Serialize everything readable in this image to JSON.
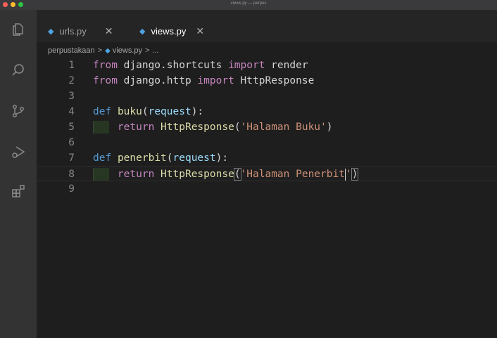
{
  "window": {
    "title": "views.py — perpus",
    "traffic_colors": [
      "#ff5f57",
      "#febc2e",
      "#28c840"
    ]
  },
  "activity_bar": {
    "icons": [
      "files-icon",
      "search-icon",
      "source-control-icon",
      "run-debug-icon",
      "extensions-icon"
    ]
  },
  "tabs": [
    {
      "label": "urls.py",
      "active": false,
      "close": "✕"
    },
    {
      "label": "views.py",
      "active": true,
      "close": "✕"
    }
  ],
  "breadcrumb": {
    "folder": "perpustakaan",
    "sep": ">",
    "file": "views.py",
    "tail": "..."
  },
  "code_lines": [
    {
      "n": "1",
      "tokens": [
        {
          "t": "from",
          "c": "kw"
        },
        {
          "t": " django.shortcuts ",
          "c": ""
        },
        {
          "t": "import",
          "c": "kw"
        },
        {
          "t": " render",
          "c": ""
        }
      ]
    },
    {
      "n": "2",
      "tokens": [
        {
          "t": "from",
          "c": "kw"
        },
        {
          "t": " django.http ",
          "c": ""
        },
        {
          "t": "import",
          "c": "kw"
        },
        {
          "t": " HttpResponse",
          "c": ""
        }
      ]
    },
    {
      "n": "3",
      "tokens": []
    },
    {
      "n": "4",
      "tokens": [
        {
          "t": "def",
          "c": "def"
        },
        {
          "t": " ",
          "c": ""
        },
        {
          "t": "buku",
          "c": "fn"
        },
        {
          "t": "(",
          "c": ""
        },
        {
          "t": "request",
          "c": "param"
        },
        {
          "t": "):",
          "c": ""
        }
      ]
    },
    {
      "n": "5",
      "indent": true,
      "tokens": [
        {
          "t": "    ",
          "c": ""
        },
        {
          "t": "return",
          "c": "kw"
        },
        {
          "t": " ",
          "c": ""
        },
        {
          "t": "HttpResponse",
          "c": "fn"
        },
        {
          "t": "(",
          "c": ""
        },
        {
          "t": "'Halaman Buku'",
          "c": "str"
        },
        {
          "t": ")",
          "c": ""
        }
      ]
    },
    {
      "n": "6",
      "tokens": []
    },
    {
      "n": "7",
      "tokens": [
        {
          "t": "def",
          "c": "def"
        },
        {
          "t": " ",
          "c": ""
        },
        {
          "t": "penerbit",
          "c": "fn"
        },
        {
          "t": "(",
          "c": ""
        },
        {
          "t": "request",
          "c": "param"
        },
        {
          "t": "):",
          "c": ""
        }
      ]
    },
    {
      "n": "8",
      "indent": true,
      "current": true,
      "tokens": [
        {
          "t": "    ",
          "c": ""
        },
        {
          "t": "return",
          "c": "kw"
        },
        {
          "t": " ",
          "c": ""
        },
        {
          "t": "HttpResponse",
          "c": "fn"
        },
        {
          "t": "(",
          "c": "bracket"
        },
        {
          "t": "'Halaman Penerbit",
          "c": "str"
        },
        {
          "t": "",
          "c": "caret"
        },
        {
          "t": "'",
          "c": "str"
        },
        {
          "t": ")",
          "c": "bracket"
        }
      ]
    },
    {
      "n": "9",
      "tokens": []
    }
  ]
}
